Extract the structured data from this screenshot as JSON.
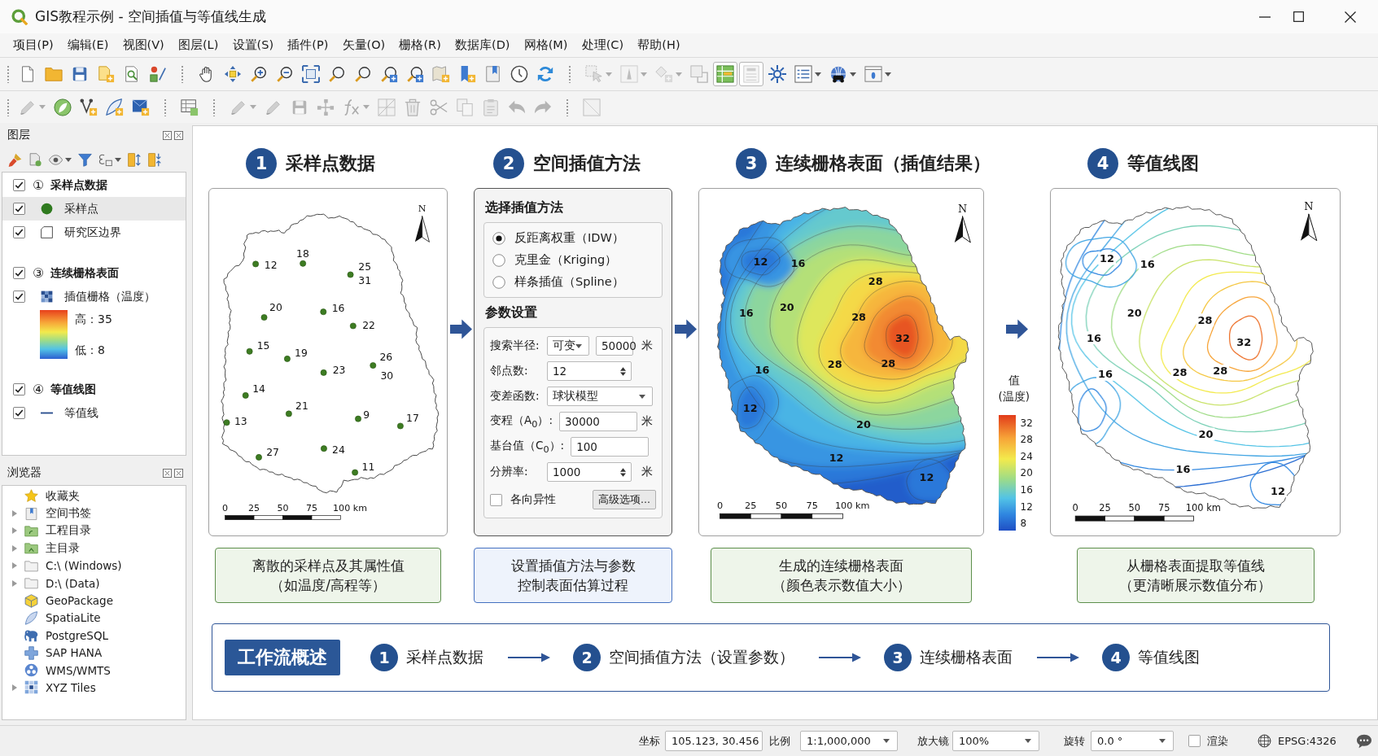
{
  "window": {
    "title": "GIS教程示例 - 空间插值与等值线生成"
  },
  "menu": [
    "项目(P)",
    "编辑(E)",
    "视图(V)",
    "图层(L)",
    "设置(S)",
    "插件(P)",
    "矢量(O)",
    "栅格(R)",
    "数据库(D)",
    "网格(M)",
    "处理(C)",
    "帮助(H)"
  ],
  "toolbars": [
    {
      "groups": [
        [
          {
            "kind": "new",
            "disabled": false,
            "pressed": false,
            "dropdown": false
          },
          {
            "kind": "open",
            "disabled": false,
            "pressed": false,
            "dropdown": false
          },
          {
            "kind": "save",
            "disabled": false,
            "pressed": false,
            "dropdown": false
          },
          {
            "kind": "save-as",
            "disabled": false,
            "pressed": false,
            "dropdown": false
          },
          {
            "kind": "layout-manager",
            "disabled": false,
            "pressed": false,
            "dropdown": false
          },
          {
            "kind": "style-manager",
            "disabled": false,
            "pressed": false,
            "dropdown": false
          }
        ],
        [
          {
            "kind": "pan",
            "disabled": false,
            "pressed": false,
            "dropdown": false
          },
          {
            "kind": "pan-selection",
            "disabled": false,
            "pressed": false,
            "dropdown": false
          },
          {
            "kind": "zoom-in",
            "disabled": false,
            "pressed": false,
            "dropdown": false
          },
          {
            "kind": "zoom-out",
            "disabled": false,
            "pressed": false,
            "dropdown": false
          },
          {
            "kind": "zoom-full",
            "disabled": false,
            "pressed": false,
            "dropdown": false
          },
          {
            "kind": "zoom-selection",
            "disabled": false,
            "pressed": false,
            "dropdown": false
          },
          {
            "kind": "zoom-layer",
            "disabled": false,
            "pressed": false,
            "dropdown": false
          },
          {
            "kind": "zoom-native",
            "disabled": false,
            "pressed": false,
            "dropdown": false
          },
          {
            "kind": "zoom-last",
            "disabled": false,
            "pressed": false,
            "dropdown": false
          },
          {
            "kind": "new-bookmark",
            "disabled": false,
            "pressed": false,
            "dropdown": false
          },
          {
            "kind": "bookmarks",
            "disabled": false,
            "pressed": false,
            "dropdown": false
          },
          {
            "kind": "bookmark-panel",
            "disabled": false,
            "pressed": false,
            "dropdown": false
          },
          {
            "kind": "temporal",
            "disabled": false,
            "pressed": false,
            "dropdown": false
          },
          {
            "kind": "refresh",
            "disabled": false,
            "pressed": false,
            "dropdown": false
          }
        ],
        [
          {
            "kind": "select",
            "disabled": true,
            "pressed": false,
            "dropdown": true
          },
          {
            "kind": "identify",
            "disabled": true,
            "pressed": false,
            "dropdown": true
          },
          {
            "kind": "shapes",
            "disabled": true,
            "pressed": false,
            "dropdown": true
          },
          {
            "kind": "square",
            "disabled": true,
            "pressed": false,
            "dropdown": false
          },
          {
            "kind": "attribute-table",
            "disabled": false,
            "pressed": true,
            "dropdown": false
          },
          {
            "kind": "field-calc",
            "disabled": true,
            "pressed": true,
            "dropdown": false
          },
          {
            "kind": "gear",
            "disabled": false,
            "pressed": false,
            "dropdown": false
          },
          {
            "kind": "list",
            "disabled": false,
            "pressed": false,
            "dropdown": true
          },
          {
            "kind": "globe",
            "disabled": false,
            "pressed": false,
            "dropdown": true
          },
          {
            "kind": "window",
            "disabled": false,
            "pressed": false,
            "dropdown": true
          }
        ]
      ]
    },
    {
      "groups": [
        [
          {
            "kind": "digitize",
            "disabled": true,
            "pressed": false,
            "dropdown": true
          },
          {
            "kind": "leaf",
            "disabled": false,
            "pressed": false,
            "dropdown": false
          },
          {
            "kind": "vertex",
            "disabled": false,
            "pressed": false,
            "dropdown": false
          },
          {
            "kind": "feather",
            "disabled": false,
            "pressed": false,
            "dropdown": false
          },
          {
            "kind": "layer",
            "disabled": false,
            "pressed": false,
            "dropdown": false
          }
        ],
        [
          {
            "kind": "attr-edit",
            "disabled": false,
            "pressed": false,
            "dropdown": false
          }
        ],
        [
          {
            "kind": "pencil",
            "disabled": true,
            "pressed": false,
            "dropdown": true
          },
          {
            "kind": "pencil",
            "disabled": true,
            "pressed": false,
            "dropdown": false
          },
          {
            "kind": "save",
            "disabled": true,
            "pressed": false,
            "dropdown": false
          },
          {
            "kind": "nodes",
            "disabled": true,
            "pressed": false,
            "dropdown": false
          },
          {
            "kind": "formula",
            "disabled": true,
            "pressed": false,
            "dropdown": true
          },
          {
            "kind": "grid",
            "disabled": true,
            "pressed": false,
            "dropdown": false
          },
          {
            "kind": "trash",
            "disabled": true,
            "pressed": false,
            "dropdown": false
          },
          {
            "kind": "scissors",
            "disabled": true,
            "pressed": false,
            "dropdown": false
          },
          {
            "kind": "copy",
            "disabled": true,
            "pressed": false,
            "dropdown": false
          },
          {
            "kind": "paste",
            "disabled": true,
            "pressed": false,
            "dropdown": false
          },
          {
            "kind": "undo",
            "disabled": true,
            "pressed": false,
            "dropdown": false
          },
          {
            "kind": "redo",
            "disabled": true,
            "pressed": false,
            "dropdown": false
          }
        ],
        [
          {
            "kind": "frame",
            "disabled": true,
            "pressed": false,
            "dropdown": false
          }
        ]
      ]
    }
  ],
  "layers_panel": {
    "title": "图层",
    "tools": [
      {
        "kind": "style",
        "dropdown": false
      },
      {
        "kind": "add-group",
        "dropdown": false
      },
      {
        "kind": "visibility",
        "dropdown": true
      },
      {
        "kind": "filter",
        "dropdown": false
      },
      {
        "kind": "expression",
        "dropdown": true
      },
      {
        "kind": "expand",
        "dropdown": false
      },
      {
        "kind": "collapse",
        "dropdown": false
      }
    ],
    "groups": [
      {
        "marker": "①",
        "label": "采样点数据",
        "checked": true,
        "layers": [
          {
            "kind": "point",
            "label": "采样点",
            "checked": true,
            "selected": true
          },
          {
            "kind": "polygon",
            "label": "研究区边界",
            "checked": true,
            "selected": false
          }
        ]
      },
      {
        "marker": "③",
        "label": "连续栅格表面",
        "checked": true,
        "layers": [
          {
            "kind": "raster",
            "label": "插值栅格（温度）",
            "checked": true,
            "selected": false,
            "legend": {
              "high": "高：35",
              "low": "低：8"
            }
          }
        ]
      },
      {
        "marker": "④",
        "label": "等值线图",
        "checked": true,
        "layers": [
          {
            "kind": "line",
            "label": "等值线",
            "checked": true,
            "selected": false
          }
        ]
      }
    ]
  },
  "browser_panel": {
    "title": "浏览器",
    "items": [
      {
        "kind": "favorites",
        "label": "收藏夹",
        "expandable": false
      },
      {
        "kind": "bookmarks",
        "label": "空间书签",
        "expandable": true
      },
      {
        "kind": "project-folder",
        "label": "工程目录",
        "expandable": true
      },
      {
        "kind": "home-folder",
        "label": "主目录",
        "expandable": true
      },
      {
        "kind": "folder",
        "label": "C:\\ (Windows)",
        "expandable": true
      },
      {
        "kind": "folder",
        "label": "D:\\ (Data)",
        "expandable": true
      },
      {
        "kind": "geopackage",
        "label": "GeoPackage",
        "expandable": false
      },
      {
        "kind": "spatialite",
        "label": "SpatiaLite",
        "expandable": false
      },
      {
        "kind": "postgresql",
        "label": "PostgreSQL",
        "expandable": false
      },
      {
        "kind": "sap",
        "label": "SAP HANA",
        "expandable": false
      },
      {
        "kind": "wms",
        "label": "WMS/WMTS",
        "expandable": false
      },
      {
        "kind": "xyz",
        "label": "XYZ Tiles",
        "expandable": true
      }
    ]
  },
  "steps": [
    {
      "kind": "points",
      "number": "1",
      "title": "采样点数据",
      "map": {
        "north": "N",
        "scale": [
          "0",
          "25",
          "50",
          "75",
          "100 km"
        ],
        "samples": [
          {
            "values": [
              "12"
            ]
          },
          {
            "values": [
              "18"
            ]
          },
          {
            "values": [
              "25",
              "31"
            ]
          },
          {
            "values": [
              "20"
            ]
          },
          {
            "values": [
              "16"
            ]
          },
          {
            "values": [
              "22"
            ]
          },
          {
            "values": [
              "15"
            ]
          },
          {
            "values": [
              "19"
            ]
          },
          {
            "values": [
              "23"
            ]
          },
          {
            "values": [
              "26",
              "30"
            ]
          },
          {
            "values": [
              "14"
            ]
          },
          {
            "values": [
              "21"
            ]
          },
          {
            "values": [
              "13"
            ]
          },
          {
            "values": [
              "9"
            ]
          },
          {
            "values": [
              "17"
            ]
          },
          {
            "values": [
              "27"
            ]
          },
          {
            "values": [
              "24"
            ]
          },
          {
            "values": [
              "11"
            ]
          }
        ]
      },
      "caption": [
        "离散的采样点及其属性值",
        "（如温度/高程等）"
      ]
    },
    {
      "kind": "method",
      "number": "2",
      "title": "空间插值方法",
      "form": {
        "title": "选择插值方法",
        "options": [
          {
            "label": "反距离权重（IDW）",
            "selected": true
          },
          {
            "label": "克里金（Kriging）",
            "selected": false
          },
          {
            "label": "样条插值（Spline）",
            "selected": false
          }
        ],
        "params_title": "参数设置",
        "params": [
          {
            "kind": "select-input",
            "label": "搜索半径:",
            "option": "可变",
            "value": "50000",
            "unit": "米"
          },
          {
            "kind": "spin",
            "label": "邻点数:",
            "value": "12"
          },
          {
            "kind": "select",
            "label": "变差函数:",
            "value": "球状模型"
          },
          {
            "kind": "input",
            "label": "变程（A$_{0}$）:",
            "value": "30000",
            "unit": "米"
          },
          {
            "kind": "input",
            "label": "基台值（C$_{0}$）:",
            "value": "100"
          },
          {
            "kind": "spin",
            "label": "分辨率:",
            "value": "1000",
            "unit": "米"
          }
        ],
        "anisotropy": {
          "label": "各向异性",
          "checked": false
        },
        "advanced": "高级选项..."
      },
      "caption": [
        "设置插值方法与参数",
        "控制表面估算过程"
      ]
    },
    {
      "kind": "raster",
      "number": "3",
      "title": "连续栅格表面（插值结果）",
      "map": {
        "north": "N",
        "scale": [
          "0",
          "25",
          "50",
          "75",
          "100 km"
        ],
        "contour_labels": [
          "12",
          "16",
          "20",
          "16",
          "28",
          "28",
          "32",
          "28",
          "28",
          "16",
          "12",
          "20",
          "12",
          "12"
        ],
        "legend": {
          "title": [
            "值",
            "(温度)"
          ],
          "ticks": [
            "32",
            "28",
            "24",
            "20",
            "16",
            "12",
            "8"
          ]
        }
      },
      "caption": [
        "生成的连续栅格表面",
        "（颜色表示数值大小）"
      ]
    },
    {
      "kind": "contours",
      "number": "4",
      "title": "等值线图",
      "map": {
        "north": "N",
        "scale": [
          "0",
          "25",
          "50",
          "75",
          "100 km"
        ],
        "contour_labels": [
          "12",
          "16",
          "20",
          "16",
          "28",
          "32",
          "28",
          "28",
          "16",
          "20",
          "16",
          "12"
        ]
      },
      "caption": [
        "从栅格表面提取等值线",
        "（更清晰展示数值分布）"
      ]
    }
  ],
  "workflow": {
    "title": "工作流概述",
    "steps": [
      {
        "number": "1",
        "label": "采样点数据"
      },
      {
        "number": "2",
        "label": "空间插值方法（设置参数）"
      },
      {
        "number": "3",
        "label": "连续栅格表面"
      },
      {
        "number": "4",
        "label": "等值线图"
      }
    ]
  },
  "status_bar": {
    "coordinate_label": "坐标",
    "coordinate": "105.123, 30.456",
    "scale_label": "比例",
    "scale": "1:1,000,000",
    "magnifier_label": "放大镜",
    "magnifier": "100%",
    "rotation_label": "旋转",
    "rotation": "0.0 °",
    "render": {
      "label": "渲染",
      "checked": false
    },
    "crs": "EPSG:4326"
  }
}
